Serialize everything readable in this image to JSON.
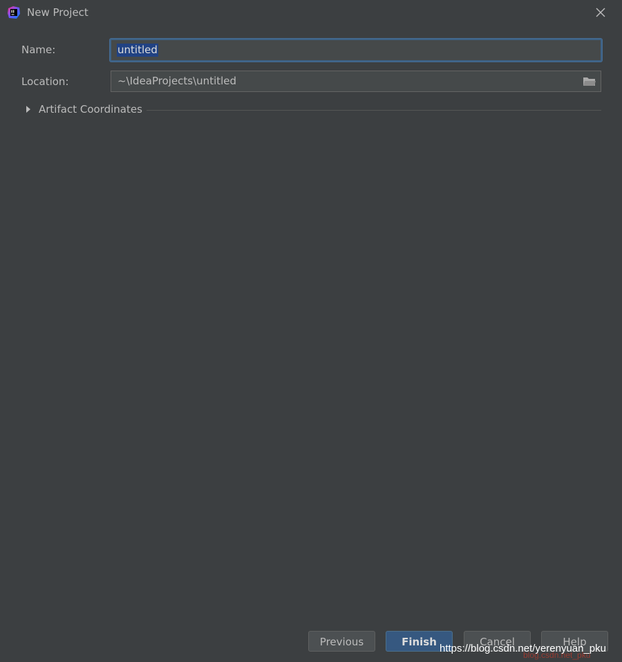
{
  "window": {
    "title": "New Project",
    "app_icon": "intellij-idea-icon",
    "close_icon": "close-icon"
  },
  "form": {
    "name": {
      "label": "Name:",
      "value": "untitled"
    },
    "location": {
      "label": "Location:",
      "value": "~\\IdeaProjects\\untitled",
      "browse_icon": "folder-icon"
    },
    "artifact": {
      "label": "Artifact Coordinates",
      "expanded": false,
      "icon": "triangle-right-icon"
    }
  },
  "buttons": {
    "previous": "Previous",
    "finish": "Finish",
    "cancel": "Cancel",
    "help": "Help"
  },
  "watermark": {
    "url": "https://blog.csdn.net/yerenyuan_pku",
    "overlay": "blog.csdn.net_pku"
  },
  "colors": {
    "background": "#3c3f41",
    "field_background": "#45494a",
    "focus_border": "#3d6185",
    "selection": "#214283",
    "default_button": "#365880"
  }
}
